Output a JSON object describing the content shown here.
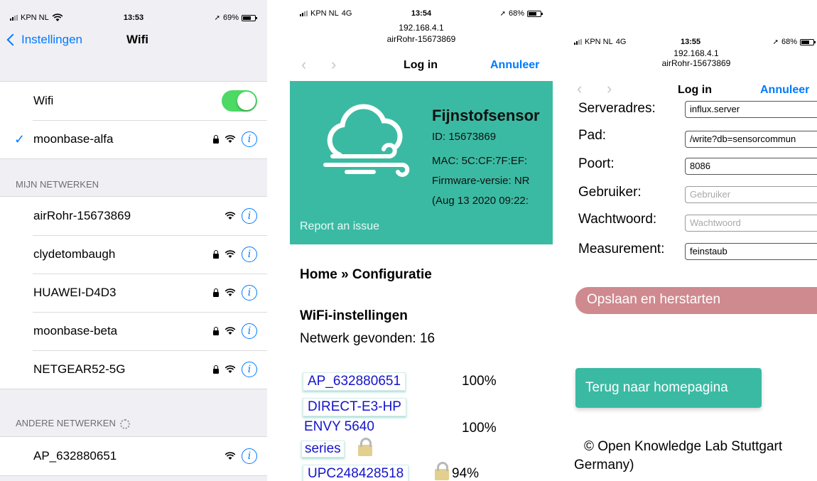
{
  "panel1": {
    "status": {
      "carrier": "KPN NL",
      "time": "13:53",
      "battery": "69%"
    },
    "nav": {
      "back_label": "Instellingen",
      "title": "Wifi"
    },
    "wifi_toggle": {
      "label": "Wifi",
      "on": true
    },
    "connected": {
      "name": "moonbase-alfa"
    },
    "my_networks_header": "MIJN NETWERKEN",
    "my_networks": [
      {
        "name": "airRohr-15673869",
        "locked": false
      },
      {
        "name": "clydetombaugh",
        "locked": true
      },
      {
        "name": "HUAWEI-D4D3",
        "locked": true
      },
      {
        "name": "moonbase-beta",
        "locked": true
      },
      {
        "name": "NETGEAR52-5G",
        "locked": true
      }
    ],
    "other_networks_header": "ANDERE NETWERKEN",
    "other_networks": [
      {
        "name": "AP_632880651",
        "locked": false
      }
    ]
  },
  "panel2": {
    "status": {
      "carrier": "KPN NL",
      "network": "4G",
      "time": "13:54",
      "battery": "68%"
    },
    "url_ip": "192.168.4.1",
    "url_ssid": "airRohr-15673869",
    "nav": {
      "title": "Log in",
      "cancel": "Annuleer"
    },
    "header": {
      "title": "Fijnstofsensor",
      "id": "ID: 15673869",
      "mac": "MAC: 5C:CF:7F:EF:",
      "firmware": "Firmware-versie: NR",
      "date": "(Aug 13 2020 09:22:",
      "report": "Report an issue"
    },
    "breadcrumb": "Home » Configuratie",
    "wifi_heading": "WiFi-instellingen",
    "networks_found": "Netwerk gevonden: 16",
    "networks": [
      {
        "name": "AP_632880651",
        "signal": "100%"
      },
      {
        "name_line1": "DIRECT-E3-HP",
        "name_line2": "ENVY 5640",
        "name_line3": "series",
        "signal": "100%"
      },
      {
        "name": "UPC248428518",
        "signal": "94%"
      }
    ]
  },
  "panel3": {
    "status": {
      "carrier": "KPN NL",
      "network": "4G",
      "time": "13:55",
      "battery": "68%"
    },
    "url_ip": "192.168.4.1",
    "url_ssid": "airRohr-15673869",
    "nav": {
      "title": "Log in",
      "cancel": "Annuleer"
    },
    "form": {
      "server": {
        "label": "Serveradres:",
        "value": "influx.server"
      },
      "path": {
        "label": "Pad:",
        "value": "/write?db=sensorcommun"
      },
      "port": {
        "label": "Poort:",
        "value": "8086"
      },
      "user": {
        "label": "Gebruiker:",
        "placeholder": "Gebruiker"
      },
      "password": {
        "label": "Wachtwoord:",
        "placeholder": "Wachtwoord"
      },
      "measurement": {
        "label": "Measurement:",
        "value": "feinstaub"
      }
    },
    "save_button": "Opslaan en herstarten",
    "home_button": "Terug naar homepagina",
    "footer_line1": "© Open Knowledge Lab Stuttgart",
    "footer_line2": "Germany)"
  },
  "colors": {
    "ios_blue": "#007aff",
    "toggle_green": "#4cd964",
    "teal": "#3bbaa3",
    "save_button": "#cf8a8f",
    "link_blue": "#1414cc"
  }
}
